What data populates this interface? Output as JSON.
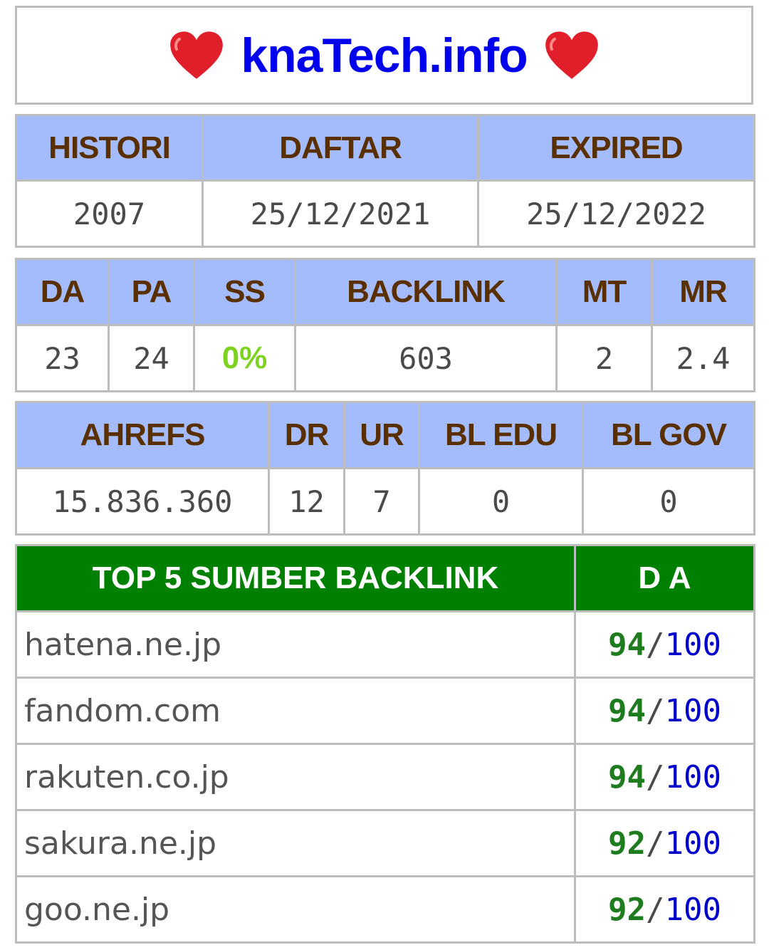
{
  "site": {
    "title": "knaTech.info",
    "left_icon": "heart-icon",
    "right_icon": "heart-icon",
    "heart_color": "#e01f2a"
  },
  "registration": {
    "headers": [
      "HISTORI",
      "DAFTAR",
      "EXPIRED"
    ],
    "values": [
      "2007",
      "25/12/2021",
      "25/12/2022"
    ]
  },
  "moz": {
    "headers": [
      "DA",
      "PA",
      "SS",
      "BACKLINK",
      "MT",
      "MR"
    ],
    "values": [
      "23",
      "24",
      "0%",
      "603",
      "2",
      "2.4"
    ]
  },
  "ahrefs": {
    "headers": [
      "AHREFS",
      "DR",
      "UR",
      "BL EDU",
      "BL GOV"
    ],
    "values": [
      "15.836.360",
      "12",
      "7",
      "0",
      "0"
    ]
  },
  "top_backlinks": {
    "headers": [
      "TOP 5 SUMBER BACKLINK",
      "D A"
    ],
    "separator": "/",
    "rows": [
      {
        "source": "hatena.ne.jp",
        "score": "94",
        "max": "100"
      },
      {
        "source": "fandom.com",
        "score": "94",
        "max": "100"
      },
      {
        "source": "rakuten.co.jp",
        "score": "94",
        "max": "100"
      },
      {
        "source": "sakura.ne.jp",
        "score": "92",
        "max": "100"
      },
      {
        "source": "goo.ne.jp",
        "score": "92",
        "max": "100"
      }
    ]
  },
  "colors": {
    "header_blue": "#a4bbfc",
    "header_text": "#5a2f00",
    "green_header": "#008000",
    "ss_green": "#7ed321",
    "score_green": "#1e7b1e",
    "max_blue": "#0000cc",
    "title_blue": "#0000ee"
  }
}
